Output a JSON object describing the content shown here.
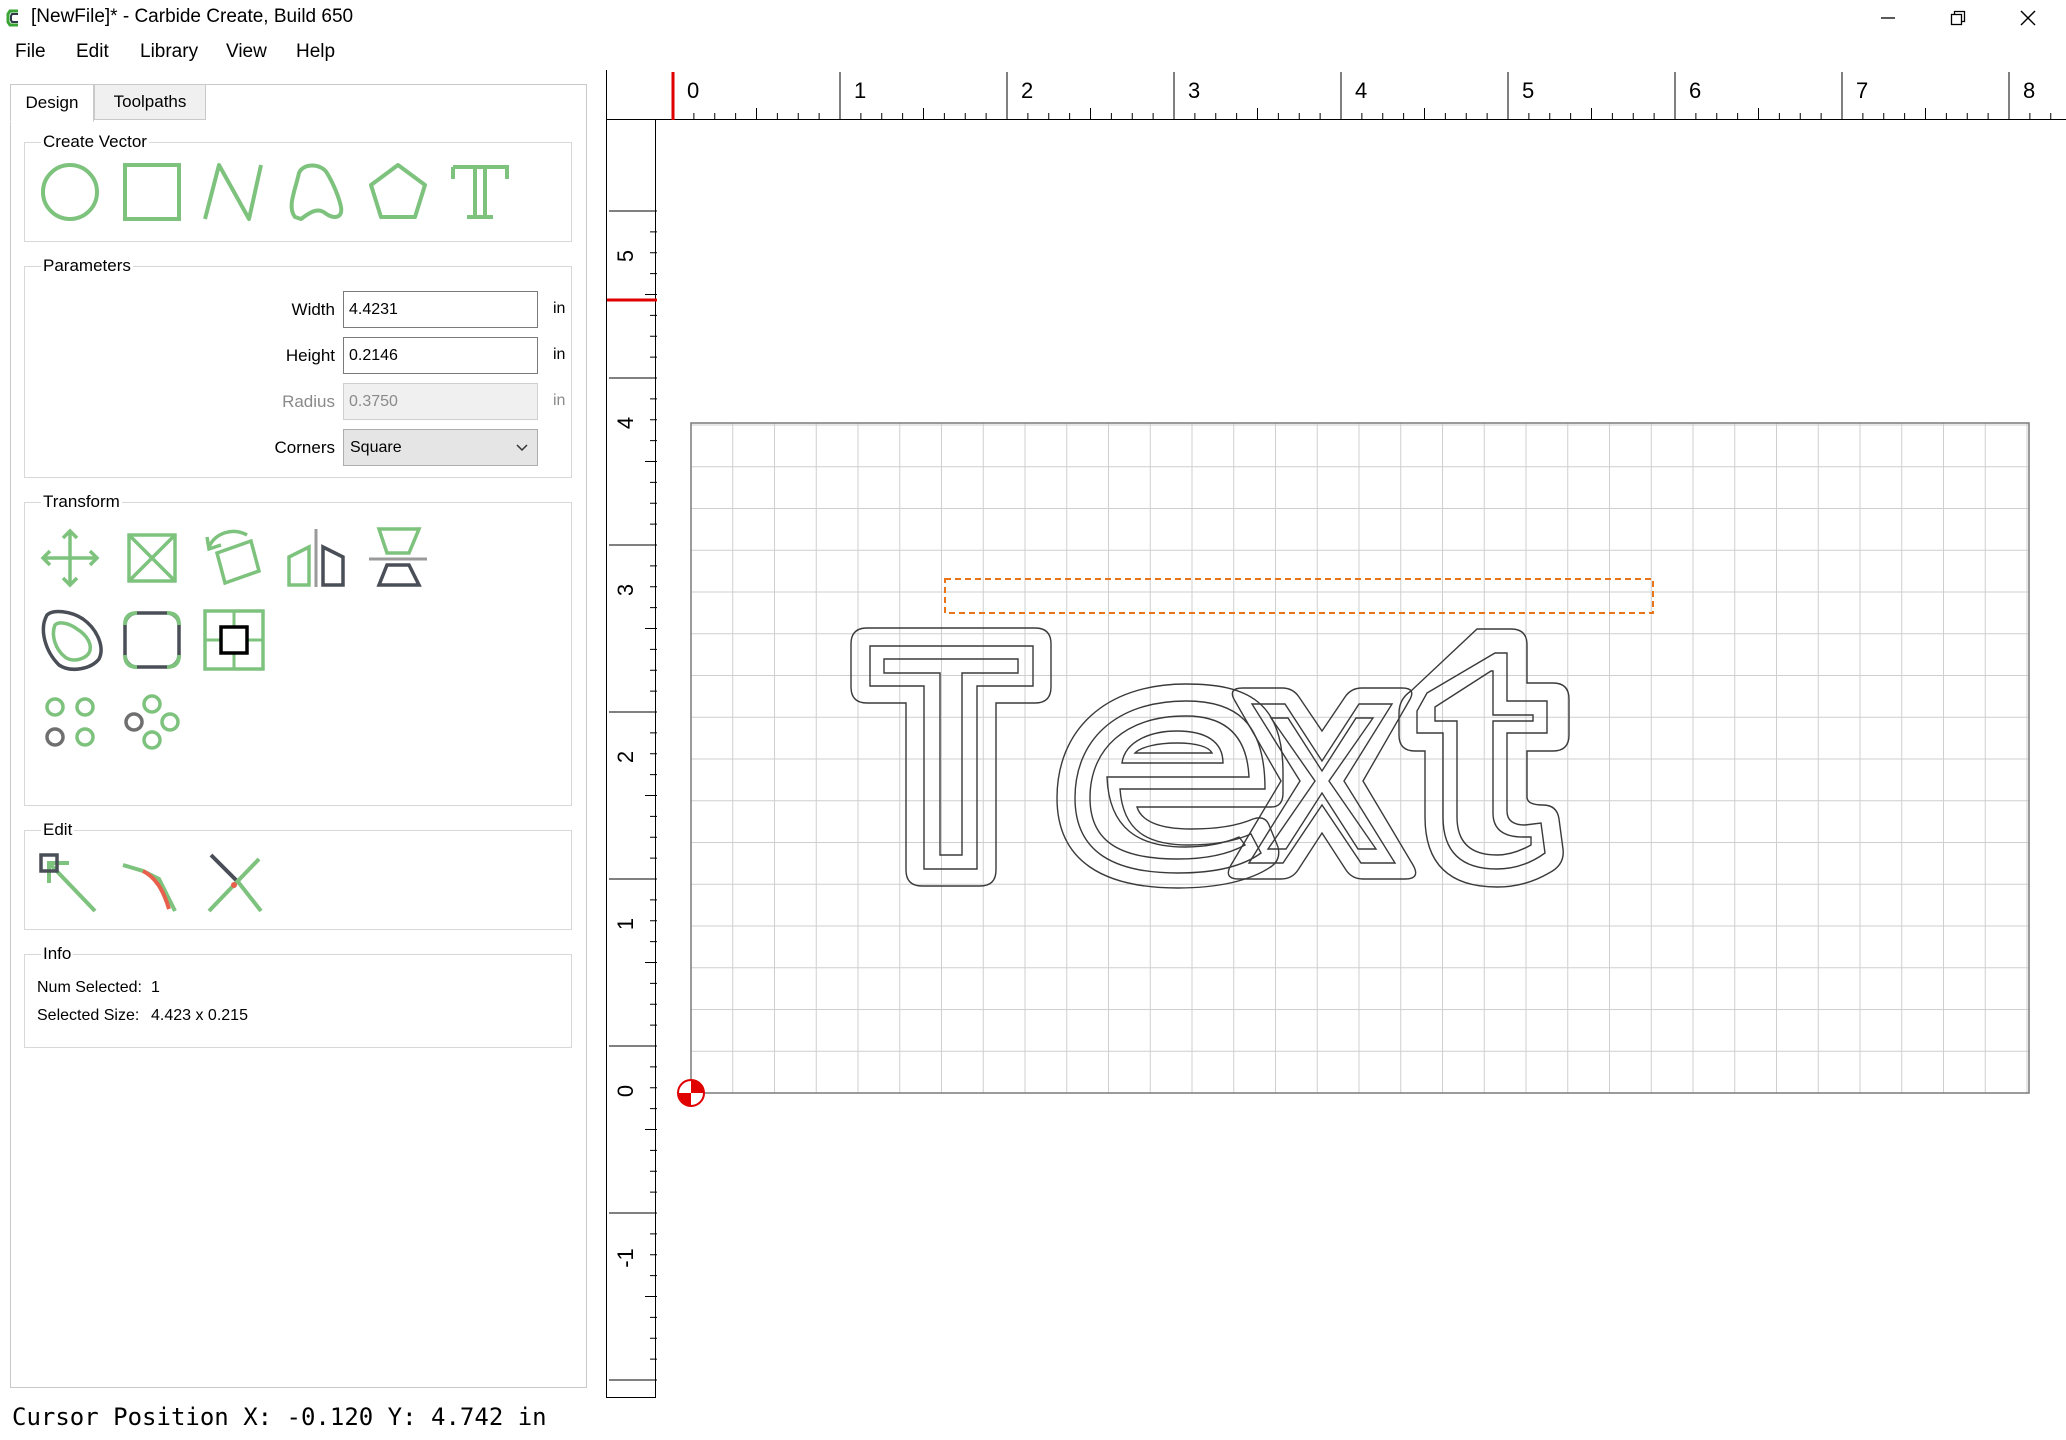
{
  "window": {
    "title": "[NewFile]* - Carbide Create, Build 650"
  },
  "menu": [
    "File",
    "Edit",
    "Library",
    "View",
    "Help"
  ],
  "tabs": [
    {
      "label": "Design",
      "active": true
    },
    {
      "label": "Toolpaths",
      "active": false
    }
  ],
  "create_vector": {
    "title": "Create Vector",
    "tools": [
      "circle-icon",
      "rectangle-icon",
      "polyline-icon",
      "curve-icon",
      "polygon-icon",
      "text-icon"
    ]
  },
  "parameters": {
    "title": "Parameters",
    "width_label": "Width",
    "width_value": "4.4231",
    "width_unit": "in",
    "height_label": "Height",
    "height_value": "0.2146",
    "height_unit": "in",
    "radius_label": "Radius",
    "radius_value": "0.3750",
    "radius_unit": "in",
    "corners_label": "Corners",
    "corners_value": "Square"
  },
  "transform": {
    "title": "Transform",
    "tools": [
      "move-icon",
      "scale-icon",
      "rotate-icon",
      "mirror-icon",
      "align-icon",
      "offset-icon",
      "fillet-icon",
      "boolean-icon",
      "grid-array-icon",
      "circular-array-icon"
    ]
  },
  "edit": {
    "title": "Edit",
    "tools": [
      "node-edit-icon",
      "join-icon",
      "trim-icon"
    ]
  },
  "info": {
    "title": "Info",
    "num_selected_label": "Num Selected:",
    "num_selected_value": "1",
    "selected_size_label": "Selected Size:",
    "selected_size_value": "4.423 x 0.215"
  },
  "ruler": {
    "x_labels": [
      "0",
      "1",
      "2",
      "3",
      "4",
      "5",
      "6",
      "7",
      "8"
    ],
    "y_labels": [
      "5",
      "4",
      "3",
      "2",
      "1",
      "0",
      "-1"
    ]
  },
  "canvas": {
    "text": "Text",
    "accent_color": "#e8741c",
    "origin_color": "#e00000"
  },
  "status": {
    "cursor_text": "Cursor Position X: -0.120 Y: 4.742 in"
  },
  "colors": {
    "tool_green": "#7dc27d",
    "tool_dark": "#4a4f57"
  }
}
